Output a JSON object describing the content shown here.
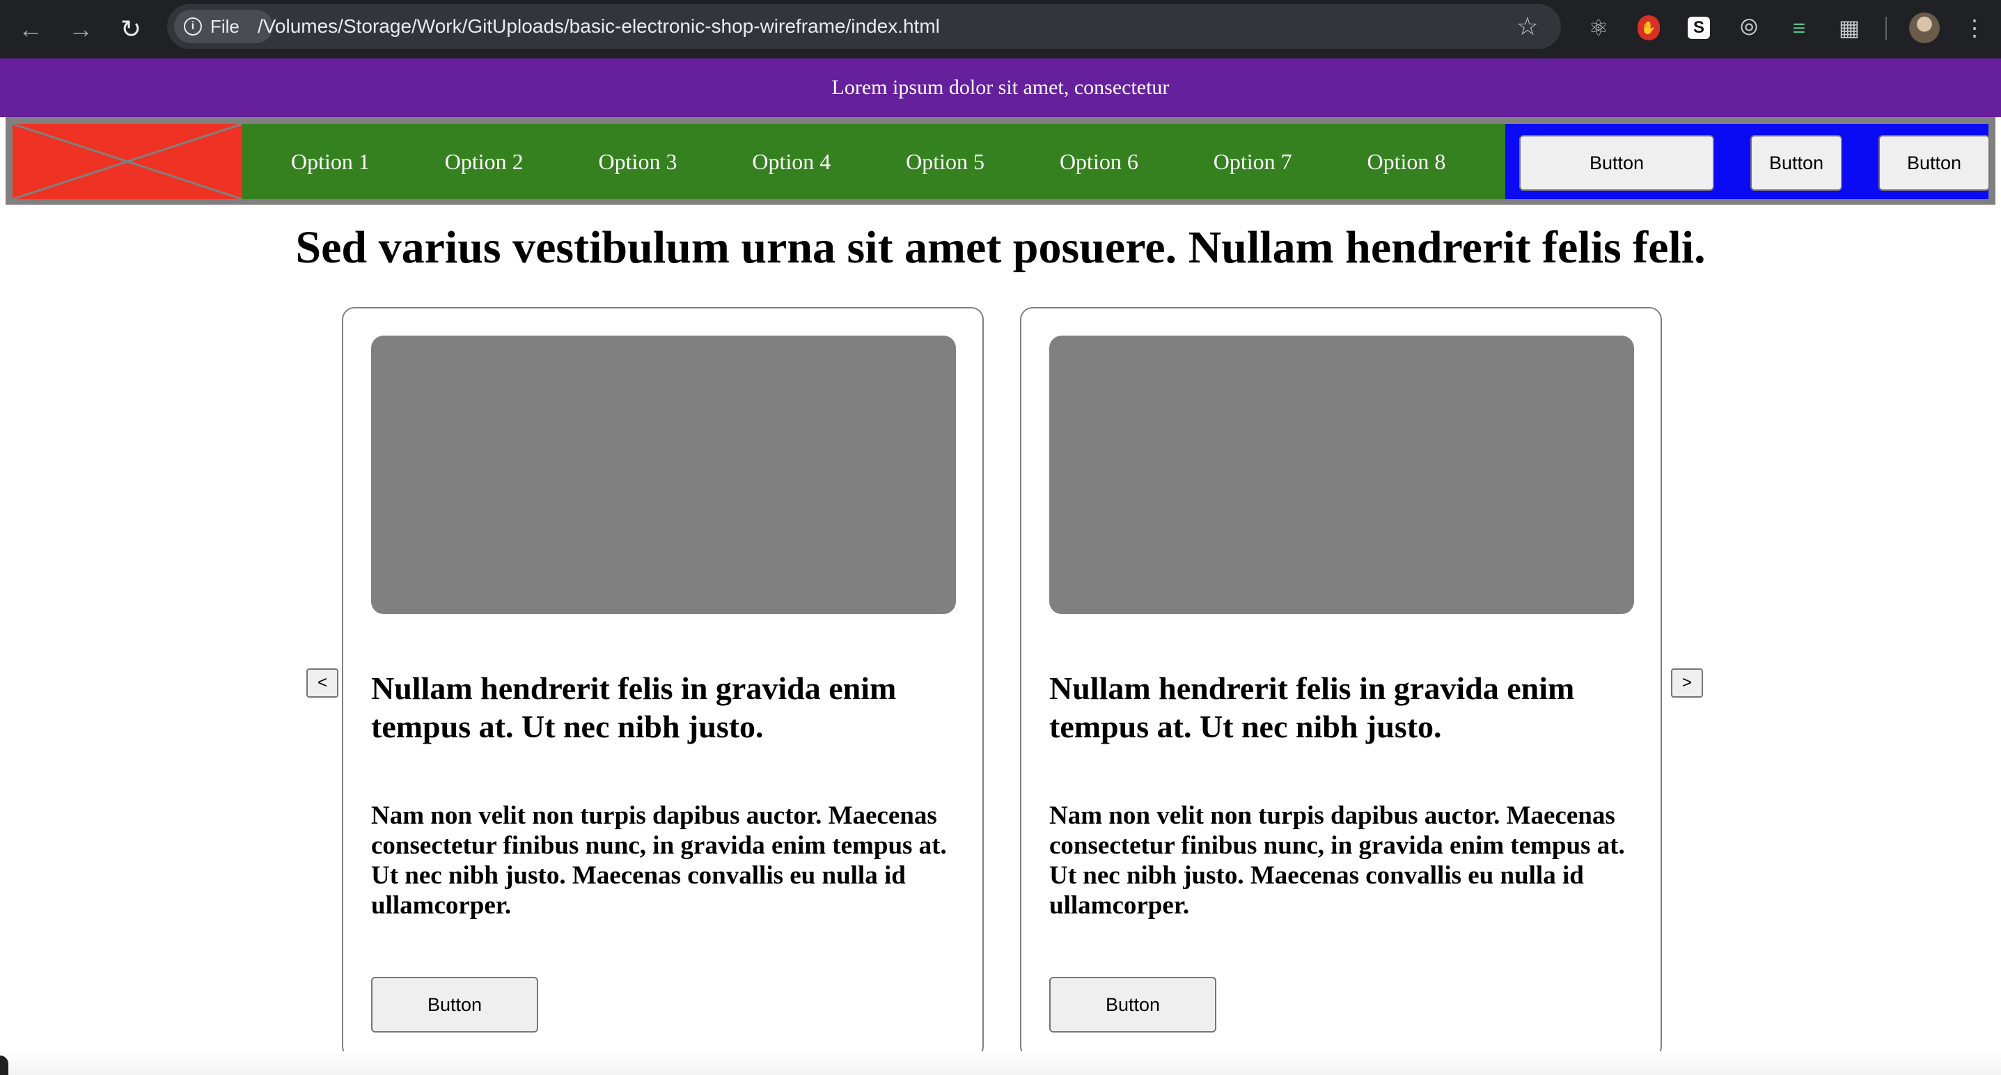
{
  "browser": {
    "file_label": "File",
    "url": "/Volumes/Storage/Work/GitUploads/basic-electronic-shop-wireframe/index.html"
  },
  "promo": {
    "text": "Lorem ipsum dolor sit amet, consectetur"
  },
  "menu": {
    "items": [
      "Option 1",
      "Option 2",
      "Option 3",
      "Option 4",
      "Option 5",
      "Option 6",
      "Option 7",
      "Option 8"
    ]
  },
  "actions": {
    "buttons": [
      "Button",
      "Button",
      "Button"
    ]
  },
  "headline": "Sed varius vestibulum urna sit amet posuere. Nullam hendrerit felis feli.",
  "carousel": {
    "prev_label": "<",
    "next_label": ">",
    "cards": [
      {
        "title": "Nullam hendrerit felis in gravida enim tempus at. Ut nec nibh justo.",
        "body": "Nam non velit non turpis dapibus auctor. Maecenas consectetur finibus nunc, in gravida enim tempus at. Ut nec nibh justo. Maecenas convallis eu nulla id ullamcorper.",
        "button": "Button"
      },
      {
        "title": "Nullam hendrerit felis in gravida enim tempus at. Ut nec nibh justo.",
        "body": "Nam non velit non turpis dapibus auctor. Maecenas consectetur finibus nunc, in gravida enim tempus at. Ut nec nibh justo. Maecenas convallis eu nulla id ullamcorper.",
        "button": "Button"
      }
    ]
  },
  "colors": {
    "promo_bg": "#66209c",
    "nav_border": "#808080",
    "logo_bg": "#ee3224",
    "menu_bg": "#35801f",
    "actions_bg": "#0a0af4",
    "card_image": "#808080"
  },
  "icons": [
    "back-arrow-icon",
    "forward-arrow-icon",
    "reload-icon",
    "info-icon",
    "star-icon",
    "react-devtools-icon",
    "ublock-icon",
    "s-extension-icon",
    "compass-icon",
    "green-extension-icon",
    "puzzle-extensions-icon",
    "kebab-menu-icon"
  ]
}
